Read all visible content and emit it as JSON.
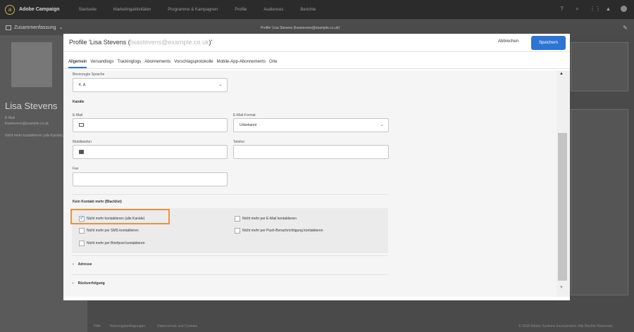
{
  "app": {
    "brand": "Adobe Campaign",
    "nav": [
      "Startseite",
      "Marketingaktivitäten",
      "Programme & Kampagnen",
      "Profile",
      "Audiences",
      "Berichte"
    ]
  },
  "background": {
    "summary_label": "Zusammenfassung",
    "profile_crumb": "Profile 'Lisa Stevens (lisastevens@example.co.uk)'",
    "name": "Lisa Stevens",
    "email_label": "E-Mail",
    "email_value": "lisastevens@example.co.uk",
    "blacklist_note": "Nicht mehr kontaktieren (alle Kanäle)",
    "footer_links": [
      "Hilfe",
      "Nutzungsbedingungen",
      "Datenschutz und Cookies"
    ],
    "copyright": "© 2016 Adobe Systems Incorporated. Alle Rechte Reserved."
  },
  "modal": {
    "title_prefix": "Profile 'Lisa Stevens (",
    "title_email": "lisastevens@example.co.uk",
    "title_suffix": ")'",
    "cancel_label": "Abbrechen",
    "save_label": "Speichern",
    "tabs": [
      "Allgemein",
      "Versandlogs",
      "Trackinglogs",
      "Abonnements",
      "Vorschlagsprotokolle",
      "Mobile-App-Abonnements",
      "Orte"
    ],
    "active_tab": "Allgemein"
  },
  "form": {
    "language_label": "Bevorzugte Sprache",
    "language_value": "K. A.",
    "channels_heading": "Kanäle",
    "email_label": "E-Mail",
    "email_value": "",
    "email_format_label": "E-Mail-Format",
    "email_format_value": "Unbekannt",
    "mobile_label": "Mobiltelefon",
    "mobile_value": "",
    "phone_label": "Telefon",
    "phone_value": "",
    "fax_label": "Fax",
    "fax_value": "",
    "blacklist_heading": "Kein Kontakt mehr (Blacklist)",
    "checkboxes": {
      "all_channels": {
        "label": "Nicht mehr kontaktieren (alle Kanäle)",
        "checked": true
      },
      "email": {
        "label": "Nicht mehr per E-Mail kontaktieren",
        "checked": false
      },
      "sms": {
        "label": "Nicht mehr per SMS kontaktieren",
        "checked": false
      },
      "push": {
        "label": "Nicht mehr per Push-Benachrichtigung kontaktieren",
        "checked": false
      },
      "post": {
        "label": "Nicht mehr per Briefpost kontaktieren",
        "checked": false
      }
    },
    "address_section": "Adresse",
    "traceability_section": "Rückverfolgung"
  },
  "colors": {
    "accent": "#2d74d4",
    "highlight": "#f0903a"
  }
}
